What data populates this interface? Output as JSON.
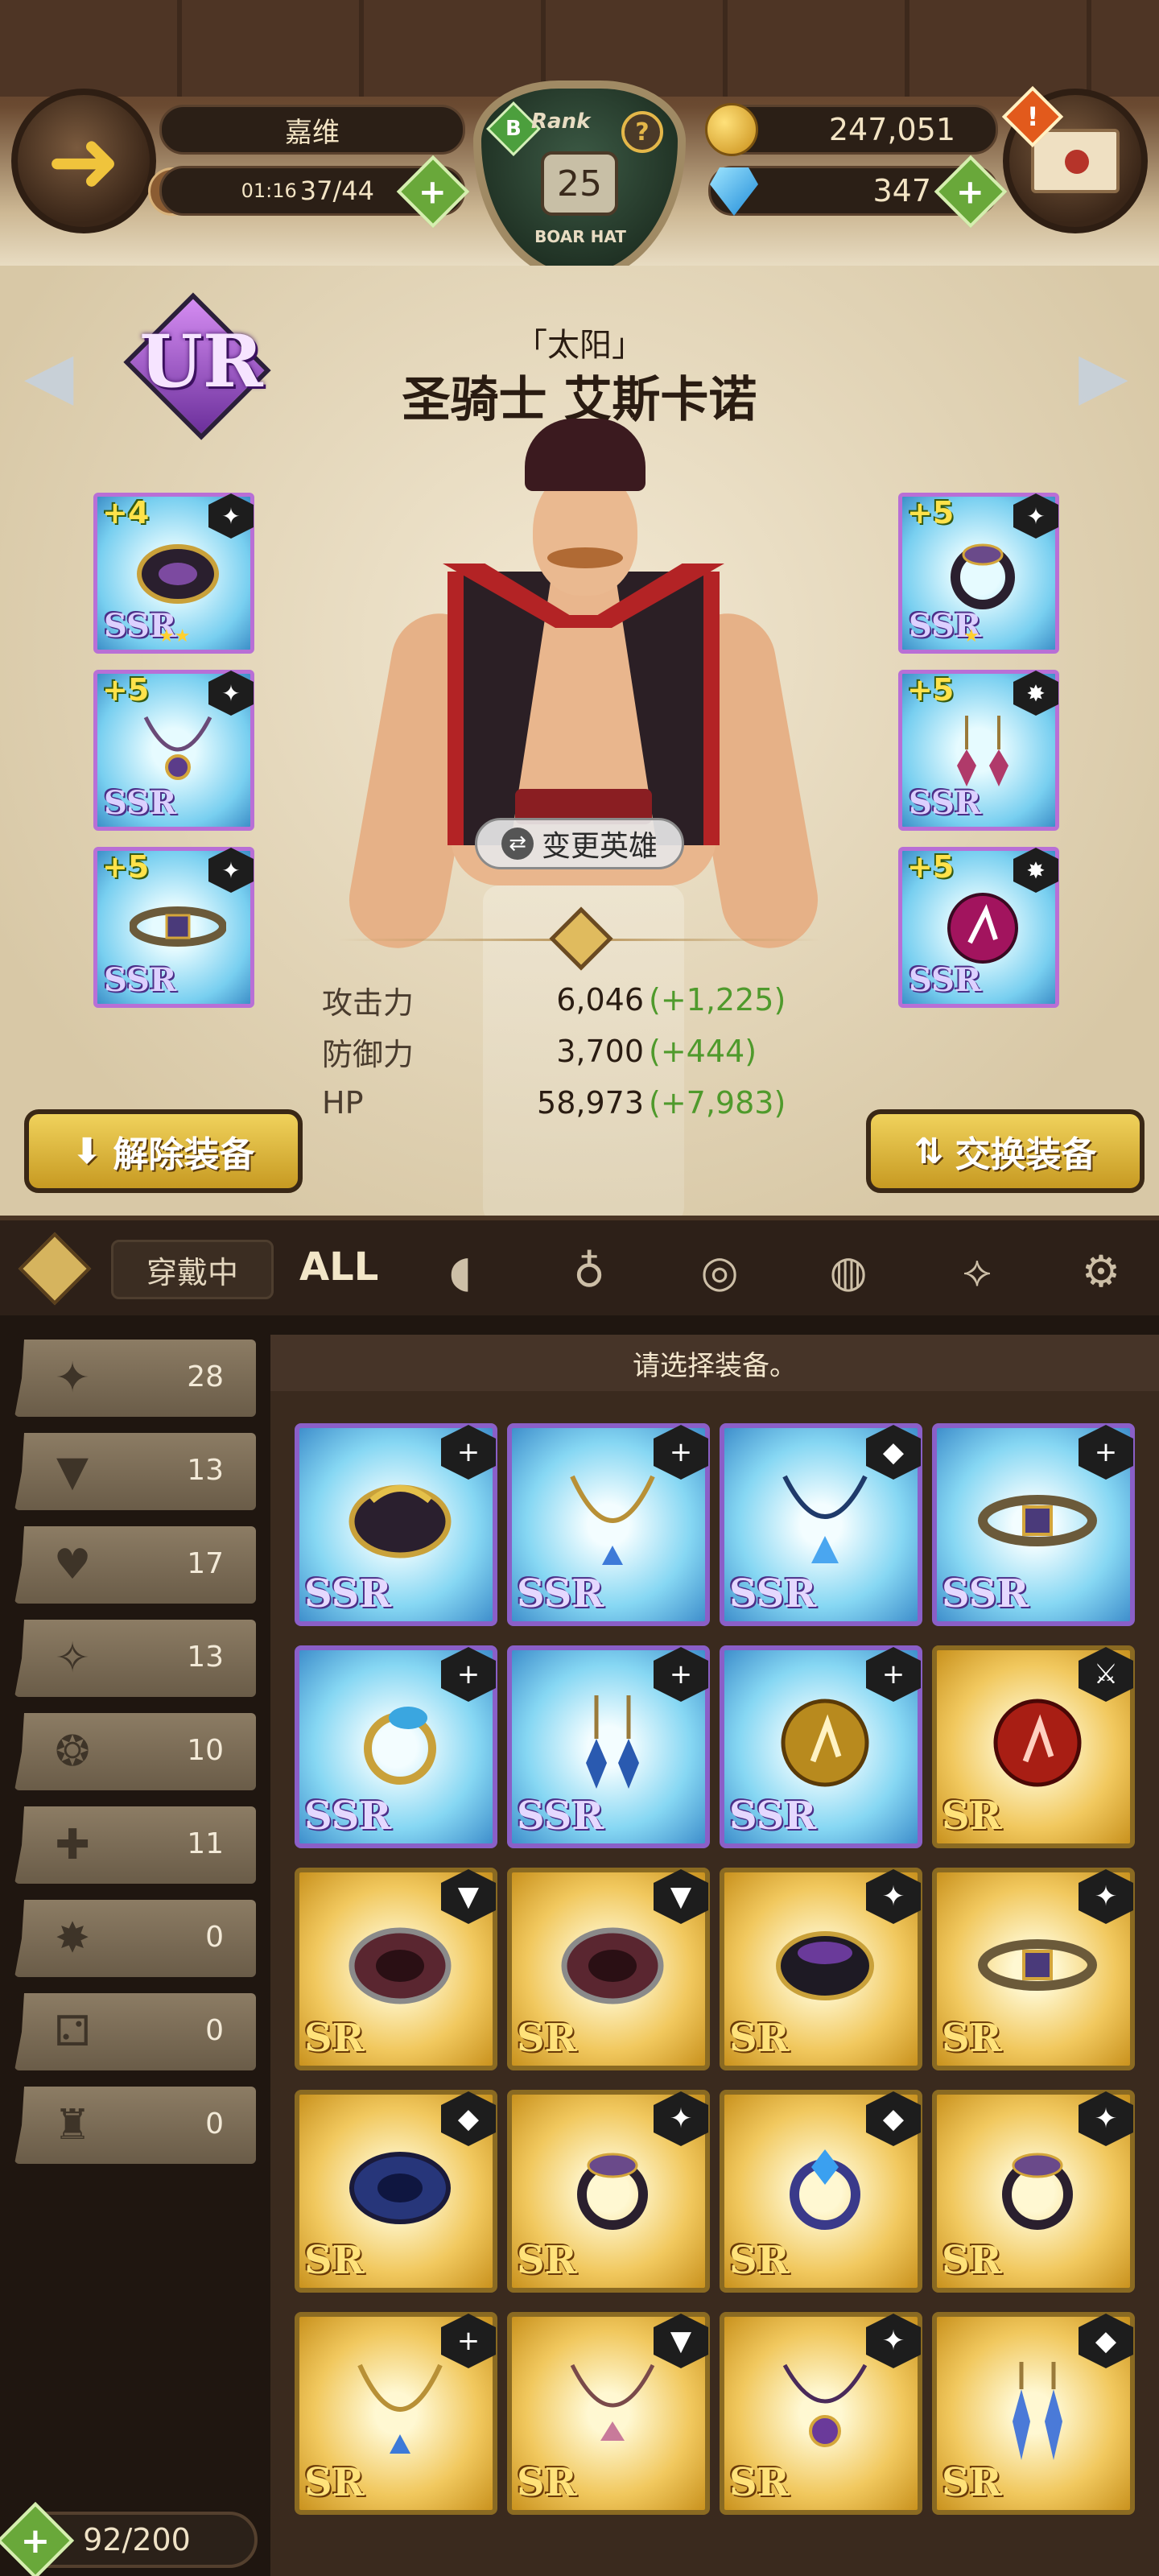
{
  "header": {
    "player_name": "嘉维",
    "stamina_timer": "01:16",
    "stamina": "37/44",
    "rank_label": "Rank",
    "rank_level": "25",
    "rank_badge": "B",
    "rank_help": "?",
    "rank_title": "BOAR HAT",
    "gold": "247,051",
    "gems": "347",
    "mail_alert": "!"
  },
  "hero": {
    "rarity": "UR",
    "subtitle": "「太阳」",
    "name": "圣骑士 艾斯卡诺",
    "change_hero_label": "变更英雄",
    "stats": [
      {
        "label": "攻击力",
        "value": "6,046",
        "bonus": "(+1,225)"
      },
      {
        "label": "防御力",
        "value": "3,700",
        "bonus": "(+444)"
      },
      {
        "label": "HP",
        "value": "58,973",
        "bonus": "(+7,983)"
      }
    ],
    "equipped_slots": [
      {
        "level": "+4",
        "rarity": "SSR",
        "type_icon": "attack-icon",
        "stars": "★★"
      },
      {
        "level": "+5",
        "rarity": "SSR",
        "type_icon": "attack-icon",
        "stars": ""
      },
      {
        "level": "+5",
        "rarity": "SSR",
        "type_icon": "attack-icon",
        "stars": ""
      },
      {
        "level": "+5",
        "rarity": "SSR",
        "type_icon": "attack-icon",
        "stars": "★"
      },
      {
        "level": "+5",
        "rarity": "SSR",
        "type_icon": "burst-icon",
        "stars": ""
      },
      {
        "level": "+5",
        "rarity": "SSR",
        "type_icon": "burst-icon",
        "stars": ""
      }
    ],
    "unequip_label": "解除装备",
    "swap_label": "交换装备"
  },
  "filters": {
    "equipped_tab": "穿戴中",
    "all_tab": "ALL",
    "category_icons": [
      "bracelet-icon",
      "necklace-icon",
      "belt-icon",
      "ring-icon",
      "earring-icon",
      "rune-icon"
    ]
  },
  "side_filters": [
    {
      "icon": "attack-icon",
      "count": "28"
    },
    {
      "icon": "defense-icon",
      "count": "13"
    },
    {
      "icon": "hp-icon",
      "count": "17"
    },
    {
      "icon": "crit-icon",
      "count": "13"
    },
    {
      "icon": "resist-icon",
      "count": "10"
    },
    {
      "icon": "recovery-icon",
      "count": "11"
    },
    {
      "icon": "burst-icon",
      "count": "0"
    },
    {
      "icon": "dice-icon",
      "count": "0"
    },
    {
      "icon": "fang-icon",
      "count": "0"
    }
  ],
  "inventory": {
    "header": "请选择装备。",
    "items": [
      {
        "rarity": "SSR",
        "badge": "+",
        "art": "bracelet"
      },
      {
        "rarity": "SSR",
        "badge": "+",
        "art": "necklace"
      },
      {
        "rarity": "SSR",
        "badge": "◆",
        "art": "necklace-blue"
      },
      {
        "rarity": "SSR",
        "badge": "+",
        "art": "belt"
      },
      {
        "rarity": "SSR",
        "badge": "+",
        "art": "ring"
      },
      {
        "rarity": "SSR",
        "badge": "+",
        "art": "earring"
      },
      {
        "rarity": "SSR",
        "badge": "+",
        "art": "rune-gold"
      },
      {
        "rarity": "SR",
        "badge": "⚔",
        "art": "rune-red"
      },
      {
        "rarity": "SR",
        "badge": "▼",
        "art": "bracelet-red"
      },
      {
        "rarity": "SR",
        "badge": "▼",
        "art": "bracelet-red"
      },
      {
        "rarity": "SR",
        "badge": "✦",
        "art": "bracelet-dark"
      },
      {
        "rarity": "SR",
        "badge": "✦",
        "art": "belt"
      },
      {
        "rarity": "SR",
        "badge": "◆",
        "art": "bracelet-blue"
      },
      {
        "rarity": "SR",
        "badge": "✦",
        "art": "ring-dark"
      },
      {
        "rarity": "SR",
        "badge": "◆",
        "art": "ring-blue"
      },
      {
        "rarity": "SR",
        "badge": "✦",
        "art": "ring-dark"
      },
      {
        "rarity": "SR",
        "badge": "+",
        "art": "necklace"
      },
      {
        "rarity": "SR",
        "badge": "▼",
        "art": "necklace-pink"
      },
      {
        "rarity": "SR",
        "badge": "✦",
        "art": "necklace-purple"
      },
      {
        "rarity": "SR",
        "badge": "◆",
        "art": "earring-blue"
      }
    ]
  },
  "footer": {
    "capacity": "92/200"
  }
}
